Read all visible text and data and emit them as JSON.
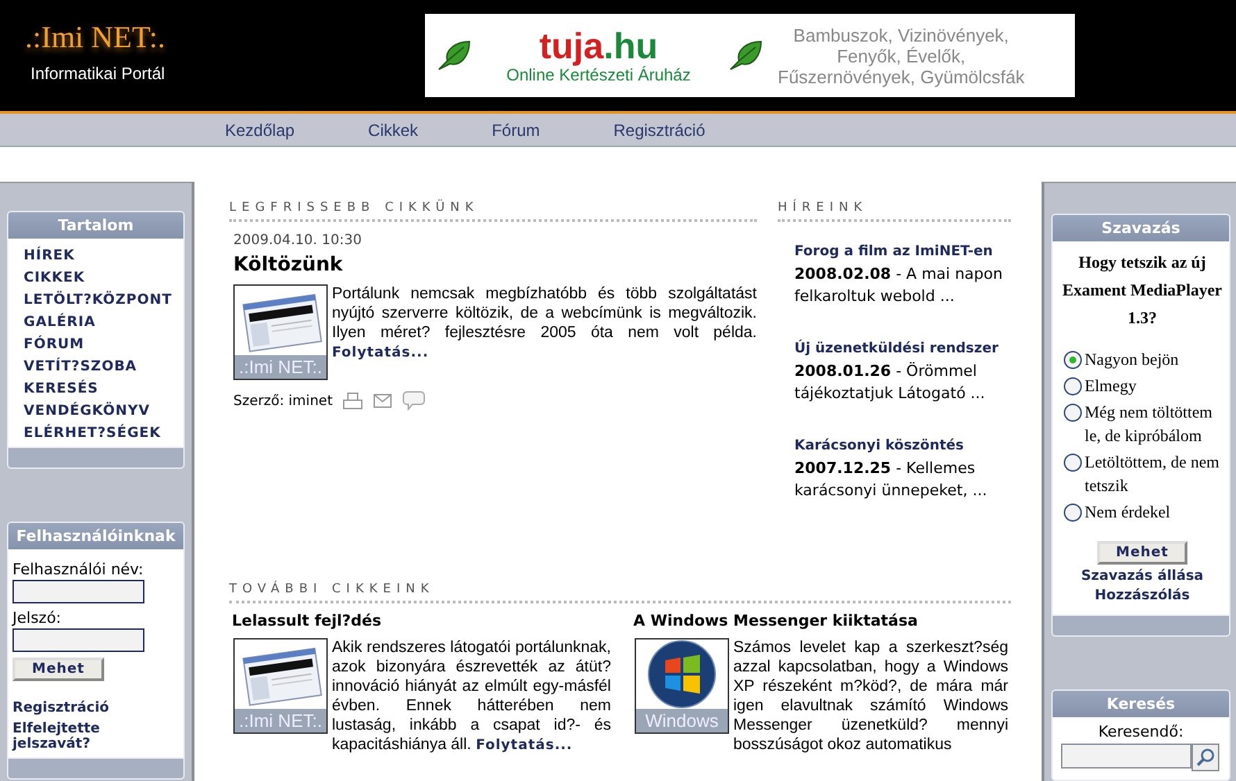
{
  "logo": {
    "title": ".:Imi NET:.",
    "subtitle": "Informatikai Portál"
  },
  "banner": {
    "brand": "tuja",
    "brand_tld": ".hu",
    "tagline": "Online Kertészeti Áruház",
    "lines": [
      "Bambuszok, Vizinövények,",
      "Fenyők, Évelők,",
      "Fűszernövények, Gyümölcsfák"
    ]
  },
  "nav": [
    {
      "label": "Kezdőlap"
    },
    {
      "label": "Cikkek"
    },
    {
      "label": "Fórum"
    },
    {
      "label": "Regisztráció"
    }
  ],
  "content_box": {
    "title": "Tartalom",
    "items": [
      "HÍREK",
      "CIKKEK",
      "LETÖLT?KÖZPONT",
      "GALÉRIA",
      "FÓRUM",
      "VETÍT?SZOBA",
      "KERESÉS",
      "VENDÉGKÖNYV",
      "ELÉRHET?SÉGEK"
    ]
  },
  "login_box": {
    "title": "Felhasználóinknak",
    "username_label": "Felhasználói név:",
    "password_label": "Jelszó:",
    "button": "Mehet",
    "links": [
      "Regisztráció",
      "Elfelejtette jelszavát?"
    ]
  },
  "latest": {
    "heading": "LEGFRISSEBB CIKKÜNK",
    "date": "2009.04.10. 10:30",
    "title": "Költözünk",
    "thumb_caption": ".:Imi NET:.",
    "body": "Portálunk nemcsak megbízhatóbb és több szolgáltatást nyújtó szerverre költözik, de a webcímünk is megváltozik. Ilyen méret? fejlesztésre 2005 óta nem volt példa.",
    "more": "Folytatás...",
    "author": "Szerző: iminet"
  },
  "news": {
    "heading": "HÍREINK",
    "items": [
      {
        "title": "Forog a film az ImiNET-en",
        "date": "2008.02.08",
        "excerpt": " - A mai napon felkaroltuk webold ..."
      },
      {
        "title": "Új üzenetküldési rendszer",
        "date": "2008.01.26",
        "excerpt": " - Örömmel tájékoztatjuk Látogató ..."
      },
      {
        "title": "Karácsonyi köszöntés",
        "date": "2007.12.25",
        "excerpt": " - Kellemes karácsonyi ünnepeket, ..."
      }
    ]
  },
  "more_articles": {
    "heading": "TOVÁBBI CIKKEINK",
    "items": [
      {
        "title": "Lelassult fejl?dés",
        "kind": "screenshot",
        "thumb_caption": ".:Imi NET:.",
        "body": "Akik rendszeres látogatói portálunknak, azok bizonyára észrevették az átüt? innováció hiányát az elmúlt egy-másfél évben. Ennek hátterében nem lustaság, inkább a csapat id?- és kapacitáshiánya áll.",
        "more": "Folytatás..."
      },
      {
        "title": "A Windows Messenger kiiktatása",
        "kind": "windows",
        "thumb_caption": "Windows",
        "body": "Számos levelet kap a szerkeszt?ség azzal kapcsolatban, hogy a Windows XP részeként m?köd?, de mára már igen elavultnak számító Windows Messenger üzenetküld? mennyi bosszúságot okoz automatikus"
      }
    ]
  },
  "poll": {
    "title": "Szavazás",
    "question": "Hogy tetszik az új Exament MediaPlayer 1.3?",
    "options": [
      {
        "label": "Nagyon bejön",
        "selected": true
      },
      {
        "label": "Elmegy",
        "selected": false
      },
      {
        "label": "Még nem töltöttem le, de kipróbálom",
        "selected": false
      },
      {
        "label": "Letöltöttem, de nem tetszik",
        "selected": false
      },
      {
        "label": "Nem érdekel",
        "selected": false
      }
    ],
    "button": "Mehet",
    "links": [
      "Szavazás állása",
      "Hozzászólás"
    ]
  },
  "search": {
    "title": "Keresés",
    "label": "Keresendő:"
  }
}
